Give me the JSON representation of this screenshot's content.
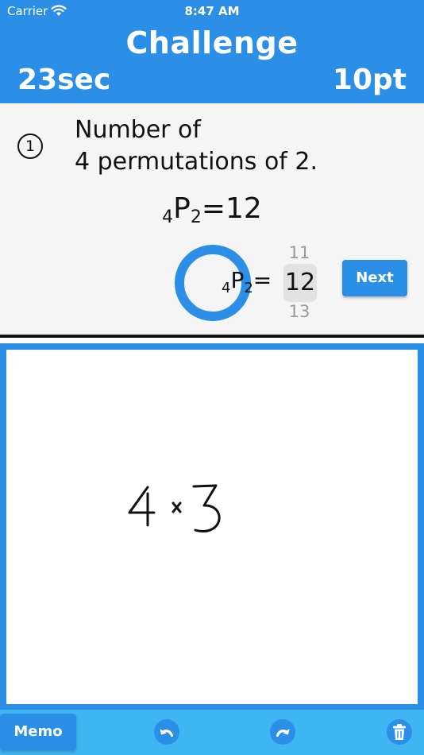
{
  "status_bar": {
    "carrier": "Carrier",
    "time": "8:47 AM"
  },
  "header": {
    "title": "Challenge",
    "timer": "23sec",
    "points": "10pt"
  },
  "question": {
    "number": "1",
    "text_line1": "Number of",
    "text_line2": "4 permutations of 2."
  },
  "formula": {
    "n": "4",
    "symbol": "P",
    "r": "2",
    "result": "=12"
  },
  "answer": {
    "n": "4",
    "symbol": "P",
    "r": "2",
    "equals": "=",
    "picker_prev": "11",
    "picker_current": "12",
    "picker_next": "13"
  },
  "buttons": {
    "next_label": "Next",
    "memo_label": "Memo"
  },
  "memo": {
    "handwriting": "4 × 3"
  },
  "colors": {
    "primary": "#2b8fe8",
    "toolbar": "#3fb5f2",
    "panel": "#f5f5f5"
  },
  "icons": {
    "undo": "undo-icon",
    "redo": "redo-icon",
    "delete": "trash-icon",
    "wifi": "wifi-icon"
  }
}
